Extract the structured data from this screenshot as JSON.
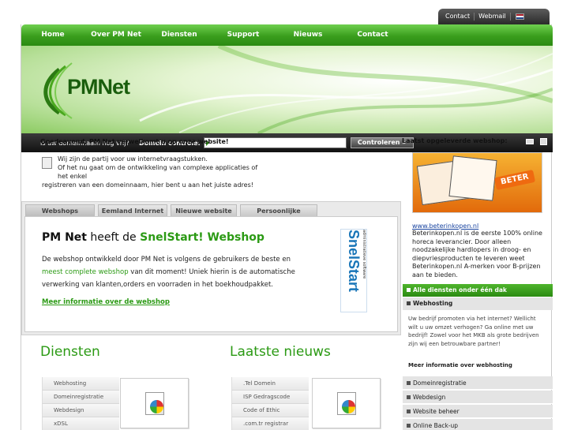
{
  "top_links": {
    "contact": "Contact",
    "webmail": "Webmail"
  },
  "nav": {
    "items": [
      "Home",
      "Over PM Net",
      "Diensten",
      "Support",
      "Nieuws",
      "Contact"
    ]
  },
  "logo": {
    "text": "PMNet"
  },
  "search": {
    "question": "Is uw domeinnaam nog vrij?",
    "label": "Domein controle:",
    "button": "Controleren »",
    "value": ""
  },
  "greeting": "Goedeavond, PM Net verwelkomt u op onze website!",
  "intro": {
    "line1": "Wij zijn de partij voor uw internetvraagstukken.",
    "line2": "Of het nu gaat om de ontwikkeling van complexe applicaties of het enkel",
    "line3": "registreren van een domeinnaam, hier bent u aan het juiste adres!"
  },
  "tabs": [
    "Webshops",
    "Eemland Internet",
    "Nieuwe website",
    "Persoonlijke afspraak"
  ],
  "promo": {
    "title_prefix": "PM Net",
    "title_mid": " heeft de ",
    "title_highlight": "SnelStart! Webshop",
    "text1": "De webshop ontwikkeld door PM Net is volgens de gebruikers de beste en",
    "text2_highlight": "meest complete webshop",
    "text2_rest": " van dit moment! Uniek hierin is de automatische",
    "text3": "verwerking van klanten,orders en voorraden in het boekhoudpakket.",
    "link": "Meer informatie over de webshop",
    "logo_text": "SnelStart",
    "logo_sub": "administratieve software"
  },
  "diensten": {
    "title": "Diensten",
    "items": [
      "Webhosting",
      "Domeinregistratie",
      "Webdesign",
      "xDSL"
    ]
  },
  "nieuws": {
    "title": "Laatste nieuws",
    "items": [
      ".Tel Domein",
      "ISP Gedragscode",
      "Code of Ethic",
      ".com.tr registrar"
    ]
  },
  "sidebar": {
    "latest_title": "Laatst opgeleverde webshop:",
    "shop_link": "www.beterinkopen.nl",
    "shop_desc": "Beterinkopen.nl is de eerste 100% online horeca leverancier. Door alleen noodzakelijke hardlopers in droog- en diepvriesproducten te leveren weet Beterinkopen.nl A-merken voor B-prijzen aan te bieden.",
    "shop_logo": "BETER",
    "all_services": "Alle diensten onder één dak",
    "webhosting_title": "Webhosting",
    "webhosting_text": "Uw bedrijf promoten via het internet? Wellicht wilt u uw omzet verhogen? Ga online met uw bedrijf! Zowel voor het MKB als grote bedrijven zijn wij een betrouwbare partner!",
    "webhosting_more": "Meer informatie over webhosting",
    "list": [
      "Domeinregistratie",
      "Webdesign",
      "Website beheer",
      "Online Back-up"
    ]
  },
  "colors": {
    "green": "#2b9a14",
    "nav_green": "#3a9e1d",
    "dark_bar": "#1a1a1a"
  }
}
